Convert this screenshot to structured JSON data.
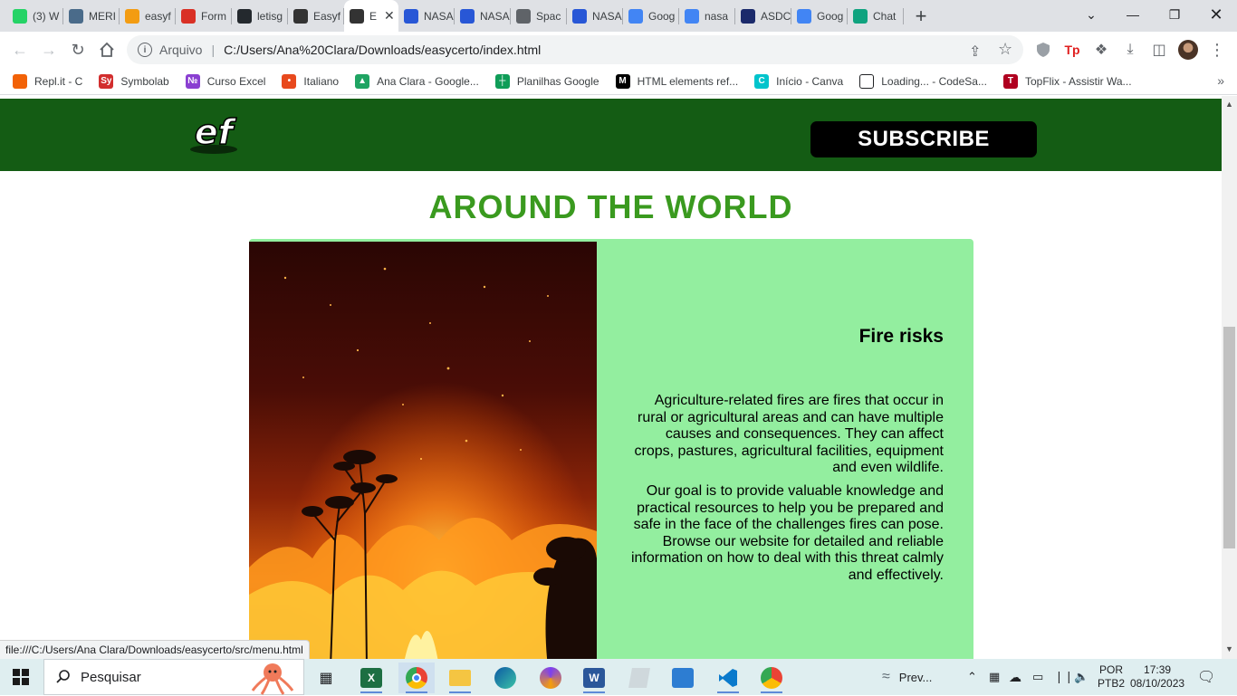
{
  "browser": {
    "tabs": [
      {
        "title": "(3) W",
        "icon": "whatsapp-icon",
        "color": "#25d366"
      },
      {
        "title": "MERI",
        "icon": "page-icon",
        "color": "#4a6b8a"
      },
      {
        "title": "easyf",
        "icon": "infinity-icon",
        "color": "#f39c12"
      },
      {
        "title": "Form",
        "icon": "forms-icon",
        "color": "#d93025"
      },
      {
        "title": "letisg",
        "icon": "github-icon",
        "color": "#24292e"
      },
      {
        "title": "Easyf",
        "icon": "ef-icon",
        "color": "#333333"
      },
      {
        "title": "E",
        "icon": "ef-icon",
        "color": "#333333",
        "active": true
      },
      {
        "title": "NASA",
        "icon": "nasa-icon",
        "color": "#2857d6"
      },
      {
        "title": "NASA",
        "icon": "nasa-icon",
        "color": "#2857d6"
      },
      {
        "title": "Spac",
        "icon": "globe-icon",
        "color": "#5f6368"
      },
      {
        "title": "NASA",
        "icon": "nasa-icon",
        "color": "#2857d6"
      },
      {
        "title": "Goog",
        "icon": "translate-icon",
        "color": "#4285f4"
      },
      {
        "title": "nasa",
        "icon": "google-icon",
        "color": "#4285f4"
      },
      {
        "title": "ASDC",
        "icon": "nasa-meatball-icon",
        "color": "#1b2a6b"
      },
      {
        "title": "Goog",
        "icon": "translate-icon",
        "color": "#4285f4"
      },
      {
        "title": "Chat",
        "icon": "chatgpt-icon",
        "color": "#10a37f"
      }
    ],
    "address": {
      "scheme_label": "Arquivo",
      "url": "C:/Users/Ana%20Clara/Downloads/easycerto/index.html"
    },
    "bookmarks": [
      {
        "label": "Repl.it - C",
        "icon": "replit-icon",
        "color": "#f26207"
      },
      {
        "label": "Symbolab",
        "icon": "symbolab-icon",
        "color": "#d22e2e",
        "glyph": "Sy"
      },
      {
        "label": "Curso Excel",
        "icon": "course-icon",
        "color": "#8a3fd1",
        "glyph": "№"
      },
      {
        "label": "Italiano",
        "icon": "flame-icon",
        "color": "#e8491d",
        "glyph": "•"
      },
      {
        "label": "Ana Clara - Google...",
        "icon": "drive-icon",
        "color": "#1fa463",
        "glyph": "▲"
      },
      {
        "label": "Planilhas Google",
        "icon": "sheets-icon",
        "color": "#0f9d58",
        "glyph": "┼"
      },
      {
        "label": "HTML elements ref...",
        "icon": "mdn-icon",
        "color": "#000000",
        "glyph": "M"
      },
      {
        "label": "Início - Canva",
        "icon": "canva-icon",
        "color": "#00c4cc",
        "glyph": "C"
      },
      {
        "label": "Loading... - CodeSa...",
        "icon": "codesandbox-icon",
        "color": "#ffffff",
        "glyph": ""
      },
      {
        "label": "TopFlix - Assistir Wa...",
        "icon": "topflix-icon",
        "color": "#b00020",
        "glyph": "T"
      }
    ],
    "status_url": "file:///C:/Users/Ana Clara/Downloads/easycerto/src/menu.html"
  },
  "site": {
    "logo_text": "ef",
    "subscribe_label": "SUBSCRIBE",
    "section_title": "AROUND THE WORLD",
    "card": {
      "title": "Fire risks",
      "paragraph_1": "Agriculture-related fires are fires that occur in rural or agricultural areas and can have multiple causes and consequences. They can affect crops, pastures, agricultural facilities, equipment and even wildlife.",
      "paragraph_2": "Our goal is to provide valuable knowledge and practical resources to help you be prepared and safe in the face of the challenges fires can pose. Browse our website for detailed and reliable information on how to deal with this threat calmly and effectively."
    },
    "colors": {
      "header_bg": "#145c14",
      "title_green": "#3a9a1f",
      "card_bg": "#93ee9f"
    }
  },
  "taskbar": {
    "search_placeholder": "Pesquisar",
    "tray_label": "Prev...",
    "lang_top": "POR",
    "lang_bottom": "PTB2",
    "time": "17:39",
    "date": "08/10/2023"
  }
}
